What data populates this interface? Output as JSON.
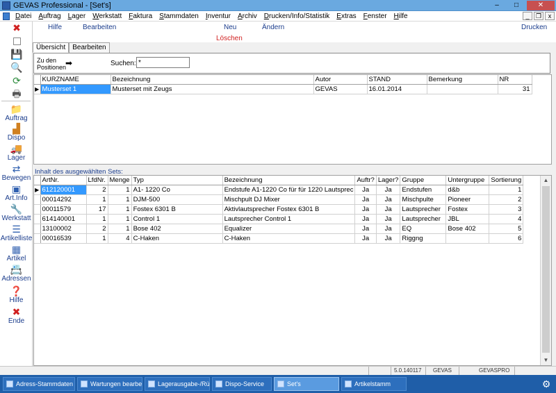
{
  "window": {
    "title": "GEVAS Professional - [Set's]",
    "minimize": "–",
    "maximize": "□",
    "close": "✕"
  },
  "menu": {
    "items": [
      "Datei",
      "Auftrag",
      "Lager",
      "Werkstatt",
      "Faktura",
      "Stammdaten",
      "Inventur",
      "Archiv",
      "Drucken/Info/Statistik",
      "Extras",
      "Fenster",
      "Hilfe"
    ],
    "mdi_buttons": [
      "_",
      "❐",
      "x"
    ]
  },
  "actions": {
    "hilfe": "Hilfe",
    "bearbeiten": "Bearbeiten",
    "neu": "Neu",
    "loeschen": "Löschen",
    "aendern": "Ändern",
    "drucken": "Drucken"
  },
  "nav": [
    {
      "label": "Auftrag"
    },
    {
      "label": "Dispo"
    },
    {
      "label": "Lager"
    },
    {
      "label": "Bewegen"
    },
    {
      "label": "Art.Info"
    },
    {
      "label": "Werkstatt"
    },
    {
      "label": "Artikelliste"
    },
    {
      "label": "Artikel"
    },
    {
      "label": "Adressen"
    },
    {
      "label": "Hilfe"
    },
    {
      "label": "Ende"
    }
  ],
  "tabs": [
    "Übersicht",
    "Bearbeiten"
  ],
  "search": {
    "goto_label": "Zu den Positionen",
    "search_label": "Suchen:",
    "search_value": "*"
  },
  "sets_grid": {
    "columns": [
      "KURZNAME",
      "Bezeichnung",
      "Autor",
      "STAND",
      "Bemerkung",
      "NR"
    ],
    "rows": [
      [
        "Musterset 1",
        "Musterset mit Zeugs",
        "GEVAS",
        "16.01.2014",
        "",
        "31"
      ]
    ]
  },
  "sets_content_label": "Inhalt des ausgewählten Sets:",
  "items_grid": {
    "columns": [
      "ArtNr.",
      "LfdNr.",
      "Menge",
      "Typ",
      "Bezeichnung",
      "Auftr?",
      "Lager?",
      "Gruppe",
      "Untergruppe",
      "Sortierung"
    ],
    "rows": [
      [
        "612120001",
        "2",
        "1",
        "A1- 1220 Co",
        "Endstufe A1-1220 Co für für 1220 Lautsprec",
        "Ja",
        "Ja",
        "Endstufen",
        "d&b",
        "1"
      ],
      [
        "00014292",
        "1",
        "1",
        "DJM-500",
        "Mischpult DJ Mixer",
        "Ja",
        "Ja",
        "Mischpulte",
        "Pioneer",
        "2"
      ],
      [
        "00011579",
        "17",
        "1",
        "Fostex 6301 B",
        "Aktivlautsprecher Fostex 6301 B",
        "Ja",
        "Ja",
        "Lautsprecher",
        "Fostex",
        "3"
      ],
      [
        "614140001",
        "1",
        "1",
        "Control 1",
        "Lautsprecher Control 1",
        "Ja",
        "Ja",
        "Lautsprecher",
        "JBL",
        "4"
      ],
      [
        "13100002",
        "2",
        "1",
        "Bose 402",
        " Equalizer",
        "Ja",
        "Ja",
        "EQ",
        "Bose 402",
        "5"
      ],
      [
        "00016539",
        "1",
        "4",
        "C-Haken",
        "C-Haken",
        "Ja",
        "Ja",
        "Riggng",
        "",
        "6"
      ]
    ]
  },
  "status": {
    "version": "5.0.140117",
    "user": "GEVAS",
    "db": "GEVASPRO"
  },
  "taskbar": [
    "Adress-Stammdaten",
    "Wartungen bearbeiten",
    "Lagerausgabe-/Rückn...",
    "Dispo-Service",
    "Set's",
    "Artikelstamm"
  ],
  "taskbar_active": "Set's",
  "colors": {
    "selection": "#3399ff",
    "link_blue": "#1a3c8c",
    "delete_red": "#d02020",
    "taskbar": "#1f5ea8"
  }
}
